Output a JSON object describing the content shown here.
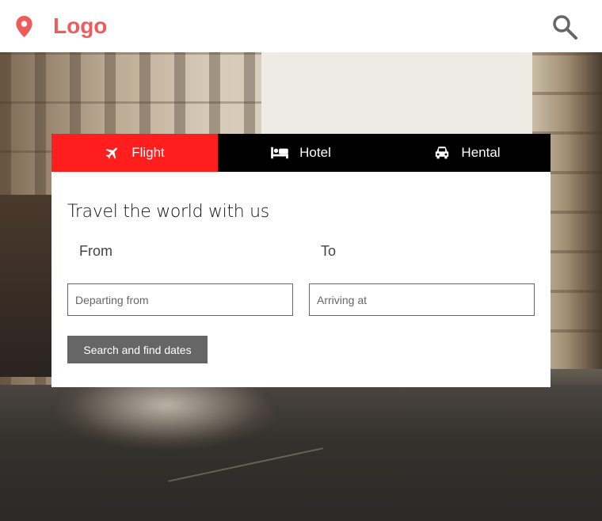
{
  "header": {
    "logo_text": "Logo",
    "icons": {
      "location": "map-pin-icon",
      "search": "search-icon"
    },
    "colors": {
      "brand": "#f05a5b",
      "icon_gray": "#666666"
    }
  },
  "tabs": [
    {
      "label": "Flight",
      "icon": "airplane-icon",
      "active": true
    },
    {
      "label": "Hotel",
      "icon": "bed-icon",
      "active": false
    },
    {
      "label": "Hental",
      "icon": "car-icon",
      "active": false
    }
  ],
  "tab_colors": {
    "active": "#ff1e1e",
    "bar": "#000000"
  },
  "form": {
    "title": "Travel the world with us",
    "from_label": "From",
    "to_label": "To",
    "from_placeholder": "Departing from",
    "to_placeholder": "Arriving at",
    "from_value": "",
    "to_value": "",
    "submit_label": "Search and find dates"
  }
}
